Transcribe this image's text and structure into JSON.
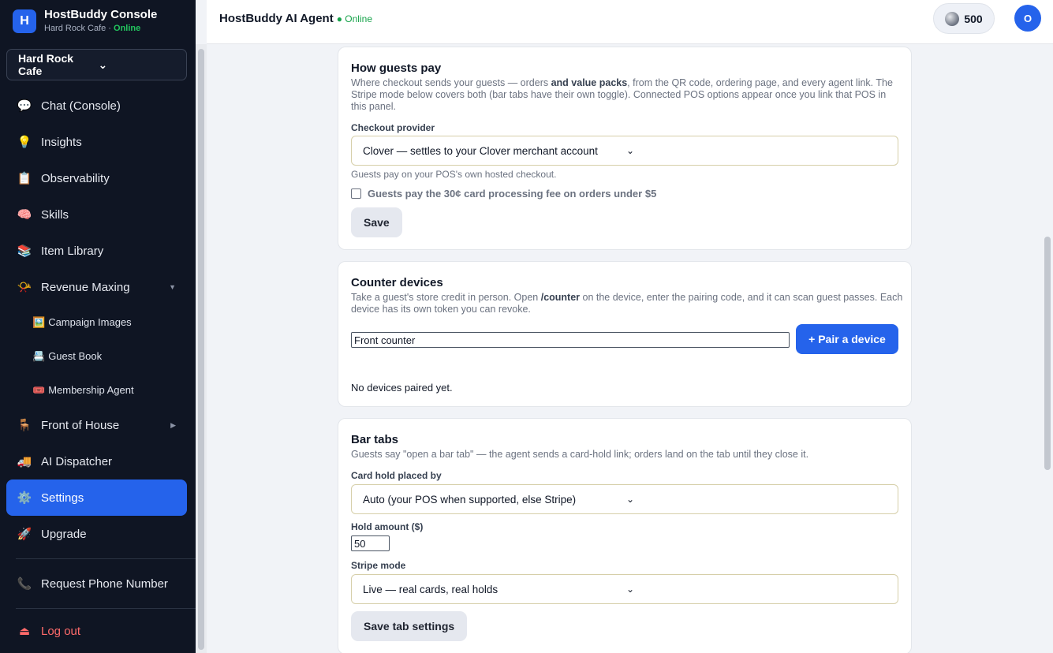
{
  "sidebar": {
    "brand": {
      "logo_letter": "H",
      "title": "HostBuddy Console",
      "subtitle": "Hard Rock Cafe · ",
      "status": "Online"
    },
    "venue": "Hard Rock Cafe",
    "items": [
      {
        "icon": "💬",
        "label": "Chat (Console)"
      },
      {
        "icon": "💡",
        "label": "Insights"
      },
      {
        "icon": "📋",
        "label": "Observability"
      },
      {
        "icon": "🧠",
        "label": "Skills"
      },
      {
        "icon": "📚",
        "label": "Item Library"
      },
      {
        "icon": "📯",
        "label": "Revenue Maxing"
      }
    ],
    "subitems": [
      {
        "icon": "🖼️",
        "label": "Campaign Images"
      },
      {
        "icon": "📇",
        "label": "Guest Book"
      },
      {
        "icon": "🎟️",
        "label": "Membership Agent"
      }
    ],
    "items2": [
      {
        "icon": "🪑",
        "label": "Front of House"
      },
      {
        "icon": "🚚",
        "label": "AI Dispatcher"
      },
      {
        "icon": "⚙️",
        "label": "Settings"
      },
      {
        "icon": "🚀",
        "label": "Upgrade"
      }
    ],
    "phone": {
      "icon": "📞",
      "label": "Request Phone Number"
    },
    "logout": {
      "icon": "⏏",
      "label": "Log out"
    }
  },
  "header": {
    "title": "HostBuddy AI Agent",
    "status": "● Online",
    "credits": "500",
    "avatar": "O"
  },
  "payments": {
    "title": "How guests pay",
    "desc_1": "Where checkout sends your guests — orders ",
    "desc_bold": "and value packs",
    "desc_2": ", from the QR code, ordering page, and every agent link. The Stripe mode below covers both (bar tabs have their own toggle). Connected POS options appear once you link that POS in this panel.",
    "provider_label": "Checkout provider",
    "provider_value": "Clover — settles to your Clover merchant account",
    "hint": "Guests pay on your POS's own hosted checkout.",
    "fee_label": "Guests pay the 30¢ card processing fee on orders under $5",
    "fee_checked": false,
    "save": "Save"
  },
  "counter": {
    "title": "Counter devices",
    "desc_1": "Take a guest's store credit in person. Open ",
    "desc_bold": "/counter",
    "desc_2": " on the device, enter the pairing code, and it can scan guest passes. Each device has its own token you can revoke.",
    "device_name": "Front counter",
    "pair_button": "+ Pair a device",
    "empty": "No devices paired yet."
  },
  "bartabs": {
    "title": "Bar tabs",
    "desc": "Guests say \"open a bar tab\" — the agent sends a card-hold link; orders land on the tab until they close it.",
    "hold_by_label": "Card hold placed by",
    "hold_by_value": "Auto (your POS when supported, else Stripe)",
    "amount_label": "Hold amount ($)",
    "amount_value": "50",
    "mode_label": "Stripe mode",
    "mode_value": "Live — real cards, real holds",
    "save": "Save tab settings"
  }
}
